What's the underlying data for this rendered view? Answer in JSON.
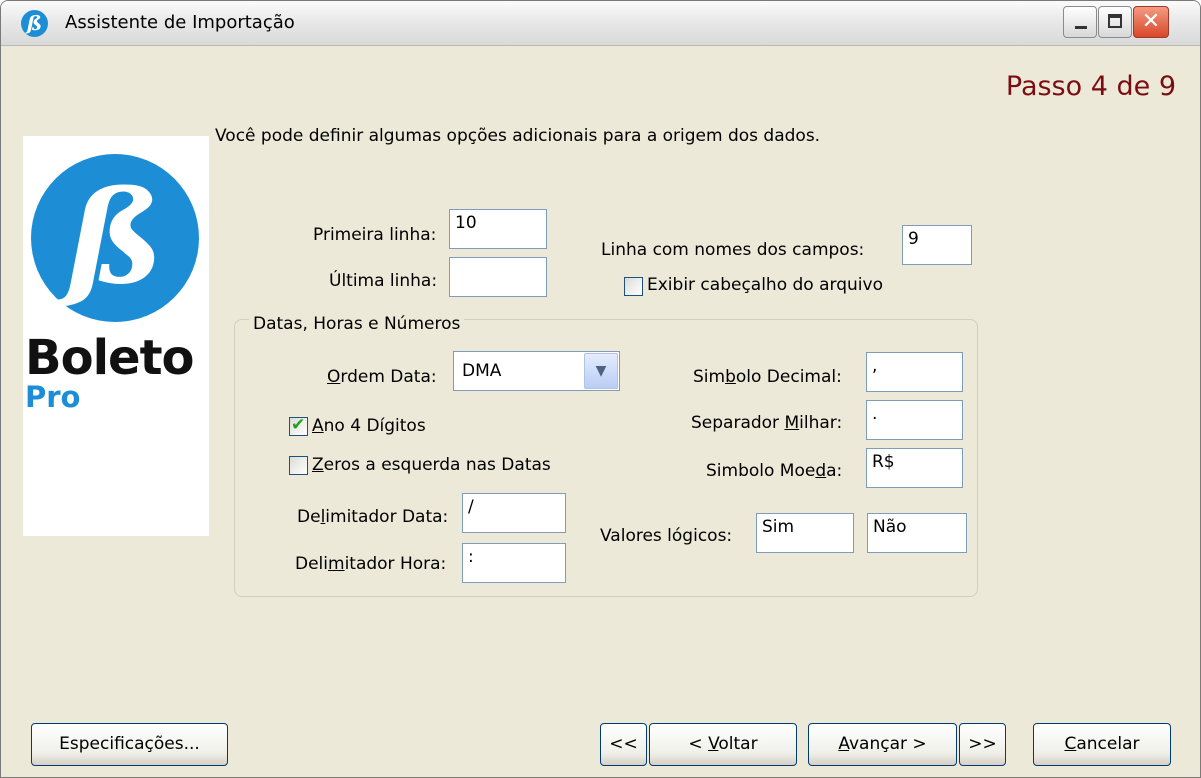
{
  "window": {
    "title": "Assistente de Importação",
    "app_icon_glyph": "ß"
  },
  "step_label": "Passo 4 de 9",
  "logo": {
    "glyph": "ß",
    "word": "Boleto",
    "sub": "Pro",
    "brand_color": "#1d8ed6"
  },
  "intro_text": "Você pode definir algumas opções adicionais para a origem dos dados.",
  "rows": {
    "first_line": {
      "label": "Primeira linha:",
      "value": "10"
    },
    "last_line": {
      "label": "Última linha:",
      "value": ""
    },
    "field_names_line": {
      "label": "Linha com nomes dos campos:",
      "value": "9"
    },
    "show_header": {
      "label": "Exibir cabeçalho do arquivo",
      "checked": false
    }
  },
  "group": {
    "title": "Datas, Horas e Números",
    "date_order": {
      "label_pre": "",
      "label_u": "O",
      "label_post": "rdem Data:",
      "value": "DMA"
    },
    "year4": {
      "label_u": "A",
      "label_post": "no 4 Dígitos",
      "checked": true
    },
    "leading_zeros": {
      "label_u": "Z",
      "label_post": "eros a esquerda nas Datas",
      "checked": false
    },
    "date_delim": {
      "label_pre": "De",
      "label_u": "l",
      "label_post": "imitador Data:",
      "value": "/"
    },
    "time_delim": {
      "label_pre": "Deli",
      "label_u": "m",
      "label_post": "itador Hora:",
      "value": ":"
    },
    "decimal_symbol": {
      "label_pre": "Sim",
      "label_u": "b",
      "label_post": "olo Decimal:",
      "value": ","
    },
    "thousand_sep": {
      "label_pre": "Separador ",
      "label_u": "M",
      "label_post": "ilhar:",
      "value": "."
    },
    "currency_symbol": {
      "label_pre": "Simbolo Moe",
      "label_u": "d",
      "label_post": "a:",
      "value": "R$"
    },
    "logical_values": {
      "label": "Valores lógicos:",
      "true_value": "Sim",
      "false_value": "Não"
    }
  },
  "buttons": {
    "specs": "Especificações...",
    "first": "<<",
    "back_pre": "< ",
    "back_u": "V",
    "back_post": "oltar",
    "next_u": "A",
    "next_post": "vançar >",
    "last": ">>",
    "cancel_u": "C",
    "cancel_post": "ancelar"
  }
}
